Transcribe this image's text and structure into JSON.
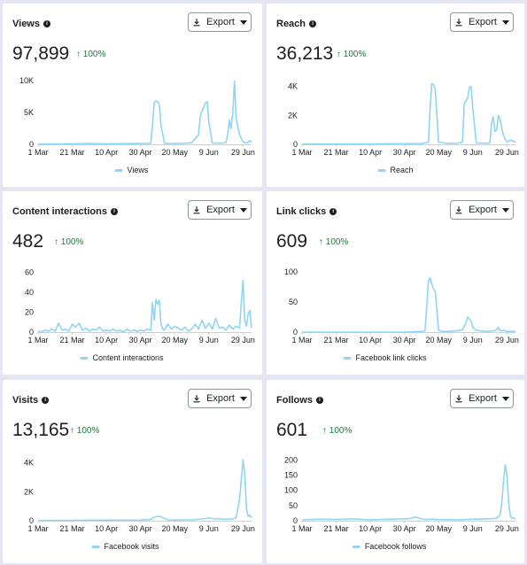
{
  "export_label": "Export",
  "chart_data": [
    {
      "id": "views",
      "type": "line",
      "title": "Views",
      "total": "97,899",
      "change": "100%",
      "legend": "Views",
      "color": "#8fd5f5",
      "yticks": [
        "0",
        "5K",
        "10K"
      ],
      "ytick_values": [
        0,
        5000,
        10000
      ],
      "ylim": [
        0,
        10000
      ],
      "x_tick_labels": [
        "1 Mar",
        "21 Mar",
        "10 Apr",
        "30 Apr",
        "20 May",
        "9 Jun",
        "29 Jun"
      ],
      "x_tick_days": [
        0,
        20,
        40,
        60,
        80,
        100,
        120
      ],
      "x": [
        0,
        10,
        20,
        30,
        40,
        50,
        60,
        66,
        67,
        68,
        69,
        70,
        71,
        72,
        74,
        76,
        80,
        84,
        90,
        94,
        95,
        96,
        97,
        98,
        99,
        100,
        102,
        108,
        110,
        111,
        112,
        113,
        114,
        115,
        116,
        118,
        120,
        122,
        124,
        125
      ],
      "values": [
        30,
        60,
        90,
        110,
        90,
        100,
        120,
        150,
        3000,
        6500,
        6800,
        6700,
        6200,
        3000,
        200,
        150,
        120,
        150,
        250,
        1500,
        4500,
        5200,
        5800,
        6500,
        6700,
        3500,
        200,
        200,
        300,
        1500,
        3800,
        2500,
        5000,
        9900,
        4000,
        1500,
        400,
        200,
        600,
        300
      ]
    },
    {
      "id": "reach",
      "type": "line",
      "title": "Reach",
      "total": "36,213",
      "change": "100%",
      "legend": "Reach",
      "color": "#8fd5f5",
      "yticks": [
        "0",
        "2K",
        "4K"
      ],
      "ytick_values": [
        0,
        2000,
        4000
      ],
      "ylim": [
        0,
        4400
      ],
      "x_tick_labels": [
        "1 Mar",
        "21 Mar",
        "10 Apr",
        "30 Apr",
        "20 May",
        "9 Jun",
        "29 Jun"
      ],
      "x_tick_days": [
        0,
        20,
        40,
        60,
        80,
        100,
        120
      ],
      "x": [
        0,
        20,
        40,
        60,
        70,
        74,
        75,
        76,
        77,
        78,
        79,
        80,
        84,
        90,
        94,
        95,
        96,
        97,
        98,
        99,
        100,
        102,
        108,
        110,
        111,
        112,
        113,
        114,
        115,
        116,
        118,
        120,
        122,
        125
      ],
      "values": [
        10,
        20,
        30,
        40,
        60,
        150,
        2500,
        4200,
        4100,
        3800,
        2000,
        150,
        80,
        60,
        150,
        2800,
        3000,
        3200,
        3900,
        4000,
        2500,
        100,
        80,
        100,
        1500,
        1900,
        900,
        1000,
        2000,
        1700,
        600,
        150,
        300,
        150
      ]
    },
    {
      "id": "content_interactions",
      "type": "line",
      "title": "Content interactions",
      "total": "482",
      "change": "100%",
      "legend": "Content interactions",
      "color": "#8fd5f5",
      "yticks": [
        "0",
        "20",
        "40",
        "60"
      ],
      "ytick_values": [
        0,
        20,
        40,
        60
      ],
      "ylim": [
        0,
        64
      ],
      "x_tick_labels": [
        "1 Mar",
        "21 Mar",
        "10 Apr",
        "30 Apr",
        "20 May",
        "9 Jun",
        "29 Jun"
      ],
      "x_tick_days": [
        0,
        20,
        40,
        60,
        80,
        100,
        120
      ],
      "x": [
        0,
        2,
        4,
        6,
        8,
        10,
        12,
        14,
        16,
        18,
        20,
        22,
        24,
        26,
        28,
        30,
        32,
        34,
        36,
        38,
        40,
        42,
        44,
        46,
        48,
        50,
        52,
        54,
        56,
        58,
        60,
        62,
        64,
        66,
        67,
        68,
        69,
        70,
        71,
        72,
        73,
        74,
        76,
        78,
        80,
        82,
        84,
        86,
        88,
        90,
        92,
        94,
        96,
        98,
        100,
        102,
        104,
        106,
        108,
        110,
        112,
        114,
        116,
        118,
        119,
        120,
        121,
        122,
        123,
        124,
        125
      ],
      "values": [
        1,
        0,
        2,
        1,
        3,
        1,
        9,
        2,
        3,
        1,
        8,
        5,
        9,
        2,
        4,
        1,
        3,
        2,
        5,
        1,
        2,
        1,
        3,
        1,
        2,
        0,
        3,
        1,
        2,
        1,
        2,
        1,
        3,
        2,
        30,
        12,
        33,
        28,
        32,
        8,
        3,
        2,
        8,
        3,
        6,
        4,
        2,
        5,
        1,
        3,
        8,
        3,
        12,
        4,
        9,
        3,
        14,
        4,
        5,
        2,
        7,
        3,
        6,
        4,
        30,
        52,
        12,
        6,
        18,
        22,
        4
      ]
    },
    {
      "id": "link_clicks",
      "type": "line",
      "title": "Link clicks",
      "total": "609",
      "change": "100%",
      "legend": "Facebook link clicks",
      "color": "#8fd5f5",
      "yticks": [
        "0",
        "50",
        "100"
      ],
      "ytick_values": [
        0,
        50,
        100
      ],
      "ylim": [
        0,
        106
      ],
      "x_tick_labels": [
        "1 Mar",
        "21 Mar",
        "10 Apr",
        "30 Apr",
        "20 May",
        "9 Jun",
        "29 Jun"
      ],
      "x_tick_days": [
        0,
        20,
        40,
        60,
        80,
        100,
        120
      ],
      "x": [
        0,
        20,
        40,
        60,
        70,
        72,
        73,
        74,
        75,
        76,
        77,
        78,
        79,
        80,
        82,
        86,
        90,
        94,
        96,
        97,
        98,
        99,
        100,
        102,
        108,
        112,
        114,
        115,
        116,
        118,
        120,
        125
      ],
      "values": [
        0,
        0,
        0,
        0,
        1,
        2,
        40,
        85,
        90,
        80,
        72,
        68,
        35,
        3,
        1,
        1,
        2,
        4,
        15,
        25,
        22,
        18,
        8,
        3,
        1,
        2,
        4,
        8,
        2,
        3,
        1,
        1
      ]
    },
    {
      "id": "visits",
      "type": "line",
      "title": "Visits",
      "total": "13,165",
      "change": "100%",
      "legend": "Facebook visits",
      "color": "#8fd5f5",
      "yticks": [
        "0",
        "2K",
        "4K"
      ],
      "ytick_values": [
        0,
        2000,
        4000
      ],
      "ylim": [
        0,
        4400
      ],
      "x_tick_labels": [
        "1 Mar",
        "21 Mar",
        "10 Apr",
        "30 Apr",
        "20 May",
        "9 Jun",
        "29 Jun"
      ],
      "x_tick_days": [
        0,
        20,
        40,
        60,
        80,
        100,
        120
      ],
      "x": [
        0,
        20,
        40,
        60,
        66,
        68,
        70,
        72,
        74,
        76,
        80,
        90,
        98,
        100,
        102,
        110,
        114,
        116,
        118,
        119,
        120,
        121,
        122,
        123,
        124,
        125
      ],
      "values": [
        20,
        30,
        40,
        50,
        80,
        250,
        300,
        280,
        150,
        60,
        50,
        60,
        150,
        200,
        150,
        100,
        120,
        200,
        1500,
        2800,
        4200,
        3300,
        900,
        300,
        400,
        200
      ]
    },
    {
      "id": "follows",
      "type": "line",
      "title": "Follows",
      "total": "601",
      "change": "100%",
      "legend": "Facebook follows",
      "color": "#8fd5f5",
      "yticks": [
        "0",
        "50",
        "100",
        "150",
        "200"
      ],
      "ytick_values": [
        0,
        50,
        100,
        150,
        200
      ],
      "ylim": [
        0,
        210
      ],
      "x_tick_labels": [
        "1 Mar",
        "21 Mar",
        "10 Apr",
        "30 Apr",
        "20 May",
        "9 Jun",
        "29 Jun"
      ],
      "x_tick_days": [
        0,
        20,
        40,
        60,
        80,
        100,
        120
      ],
      "x": [
        0,
        10,
        20,
        30,
        40,
        50,
        60,
        64,
        66,
        68,
        70,
        72,
        76,
        80,
        90,
        100,
        108,
        114,
        116,
        117,
        118,
        119,
        120,
        121,
        122,
        123,
        124,
        125
      ],
      "values": [
        3,
        5,
        4,
        6,
        3,
        5,
        6,
        8,
        12,
        10,
        6,
        4,
        5,
        4,
        3,
        5,
        6,
        8,
        20,
        60,
        130,
        185,
        150,
        60,
        15,
        8,
        10,
        5
      ]
    }
  ]
}
